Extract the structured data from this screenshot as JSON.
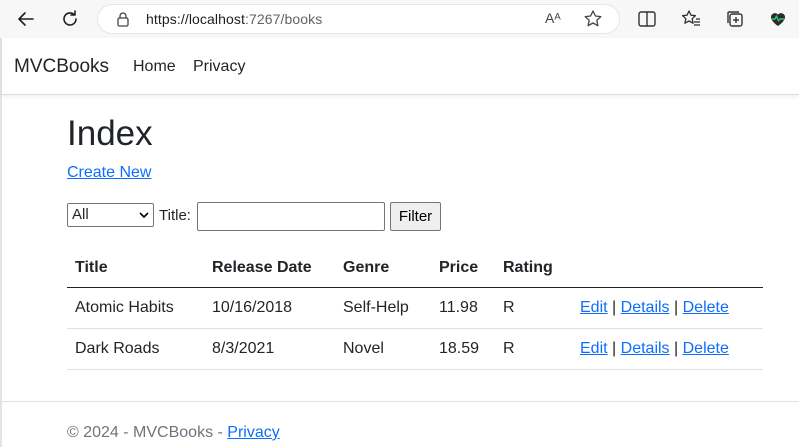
{
  "browser": {
    "url_host": "https://localhost",
    "url_path": ":7267/books",
    "read_aloud_label": "Aᴬ"
  },
  "site": {
    "brand": "MVCBooks",
    "nav": [
      {
        "label": "Home"
      },
      {
        "label": "Privacy"
      }
    ]
  },
  "page": {
    "title": "Index",
    "create_link": "Create New"
  },
  "filter": {
    "genre_selected": "All",
    "title_label": "Title:",
    "title_value": "",
    "button_label": "Filter"
  },
  "table": {
    "headers": [
      "Title",
      "Release Date",
      "Genre",
      "Price",
      "Rating",
      ""
    ],
    "rows": [
      {
        "title": "Atomic Habits",
        "release_date": "10/16/2018",
        "genre": "Self-Help",
        "price": "11.98",
        "rating": "R"
      },
      {
        "title": "Dark Roads",
        "release_date": "8/3/2021",
        "genre": "Novel",
        "price": "18.59",
        "rating": "R"
      }
    ],
    "actions": {
      "edit": "Edit",
      "details": "Details",
      "delete": "Delete",
      "separator": "|"
    }
  },
  "footer": {
    "text": "© 2024 - MVCBooks - ",
    "privacy_link": "Privacy"
  },
  "colors": {
    "link": "#0d6efd",
    "text": "#212529",
    "muted": "#6c757d"
  }
}
